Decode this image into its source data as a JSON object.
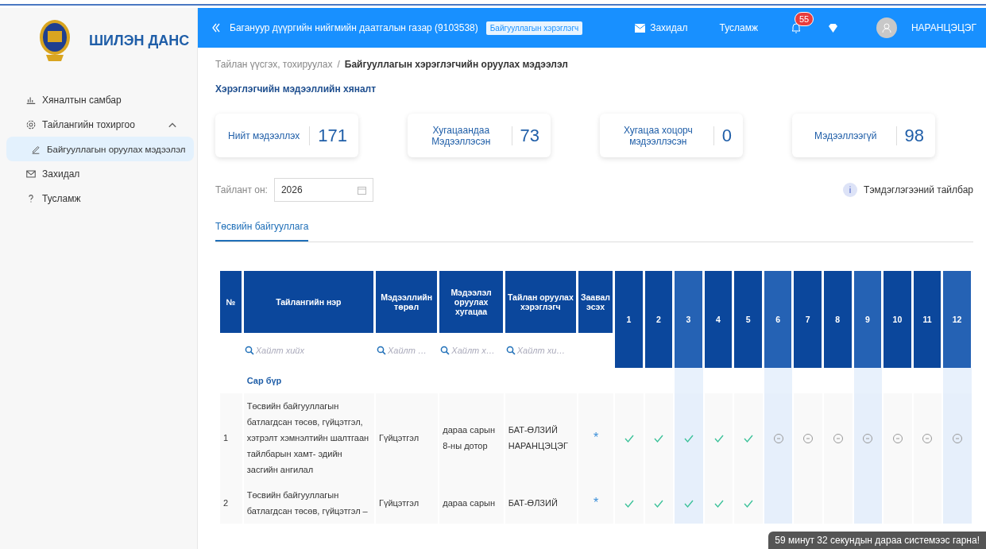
{
  "header": {
    "title": "Багануур дүүргийн нийгмийн даатгалын газар (9103538)",
    "role_badge": "Байгууллагын хэрэглэгч",
    "mail": "Захидал",
    "help": "Тусламж",
    "notification_count": "55",
    "user": "НАРАНЦЭЦЭГ"
  },
  "sidebar": {
    "brand": "ШИЛЭН ДАНС",
    "items": [
      {
        "label": "Хяналтын самбар",
        "selected": false
      },
      {
        "label": "Тайлангийн тохиргоо",
        "selected": false,
        "expanded": true,
        "children": [
          {
            "label": "Байгууллагын оруулах мэдээлэл",
            "selected": true
          }
        ]
      },
      {
        "label": "Захидал",
        "selected": false
      },
      {
        "label": "Тусламж",
        "selected": false
      }
    ]
  },
  "breadcrumb": [
    "Тайлан үүсгэх, тохируулах",
    "Байгууллагын хэрэглэгчийн оруулах мэдээлэл"
  ],
  "breadcrumb_separator": "/",
  "section_title": "Хэрэглэгчийн мэдээллийн хяналт",
  "stats": [
    {
      "label": "Нийт мэдээллэх",
      "value": "171"
    },
    {
      "label": "Хугацаандаа Мэдээллэсэн",
      "value": "73"
    },
    {
      "label": "Хугацаа хоцорч мэдээллэсэн",
      "value": "0"
    },
    {
      "label": "Мэдээллээгүй",
      "value": "98"
    }
  ],
  "year_filter": {
    "label": "Тайлант он:",
    "value": "2026"
  },
  "legend_link": "Тэмдэглэгээний тайлбар",
  "tabs": [
    {
      "label": "Төсвийн байгууллага",
      "selected": true
    }
  ],
  "table": {
    "columns": [
      "№",
      "Тайлангийн нэр",
      "Мэдээллийн төрөл",
      "Мэдээлэл оруулах хугацаа",
      "Тайлан оруулах хэрэглэгч",
      "Заавал эсэх"
    ],
    "month_columns": [
      {
        "label": "1",
        "highlighted": false
      },
      {
        "label": "2",
        "highlighted": false
      },
      {
        "label": "3",
        "highlighted": true
      },
      {
        "label": "4",
        "highlighted": false
      },
      {
        "label": "5",
        "highlighted": false
      },
      {
        "label": "6",
        "highlighted": true
      },
      {
        "label": "7",
        "highlighted": false
      },
      {
        "label": "8",
        "highlighted": false
      },
      {
        "label": "9",
        "highlighted": true
      },
      {
        "label": "10",
        "highlighted": false
      },
      {
        "label": "11",
        "highlighted": false
      },
      {
        "label": "12",
        "highlighted": true
      }
    ],
    "search_placeholders": [
      "Хайлт хийх",
      "Хайлт …",
      "Хайлт х…",
      "Хайлт хи…"
    ],
    "group_label": "Сар бүр",
    "rows": [
      {
        "no": "1",
        "name": "Төсвийн байгууллагын батлагдсан төсөв, гүйцэтгэл, хэтрэлт хэмнэлтийн шалтгаан тайлбарын хамт- эдийн засгийн ангилал",
        "type": "Гүйцэтгэл",
        "deadline": "дараа сарын 8-ны дотор",
        "user": "БАТ-ӨЛЗИЙ НАРАНЦЭЦЭГ",
        "mandatory": "*",
        "months": [
          {
            "done": true
          },
          {
            "done": true
          },
          {
            "done": true
          },
          {
            "done": true
          },
          {
            "done": true
          },
          {
            "done": false
          },
          {
            "done": false
          },
          {
            "done": false
          },
          {
            "done": false
          },
          {
            "done": false
          },
          {
            "done": false
          },
          {
            "done": false
          }
        ]
      },
      {
        "no": "2",
        "name": "Төсвийн байгууллагын батлагдсан төсөв, гүйцэтгэл –",
        "type": "Гүйцэтгэл",
        "deadline": "дараа сарын",
        "user": "БАТ-ӨЛЗИЙ",
        "mandatory": "*",
        "months": [
          {
            "done": true
          },
          {
            "done": true
          },
          {
            "done": true
          },
          {
            "done": true
          },
          {
            "done": true
          }
        ]
      }
    ]
  },
  "toast": "59 минут 32 секундын дараа системээс гарна!"
}
